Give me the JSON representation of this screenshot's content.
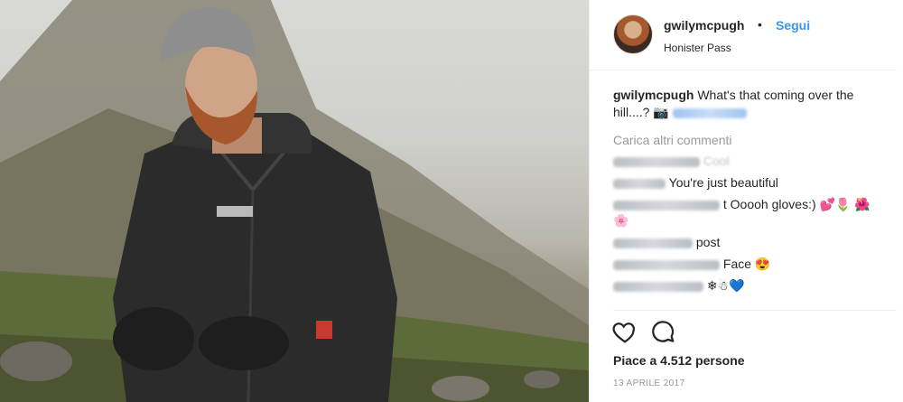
{
  "post": {
    "username": "gwilymcpugh",
    "separator": "•",
    "follow_label": "Segui",
    "location": "Honister Pass",
    "caption_user": "gwilymcpugh",
    "caption_text": "What's that coming over the hill....? 📷",
    "load_more": "Carica altri commenti",
    "comments": [
      {
        "text": "Cool"
      },
      {
        "text": "You're just beautiful"
      },
      {
        "text": "t Ooooh gloves:) 💕🌷 🌺🌸"
      },
      {
        "text": "post"
      },
      {
        "text": "Face 😍"
      },
      {
        "text": "❄☃💙"
      }
    ],
    "likes": "Piace a 4.512 persone",
    "date": "13 APRILE 2017"
  },
  "icons": [
    "heart-icon",
    "comment-icon"
  ],
  "colors": {
    "accent": "#3897f0",
    "text": "#262626",
    "muted": "#999999",
    "border": "#efefef"
  }
}
